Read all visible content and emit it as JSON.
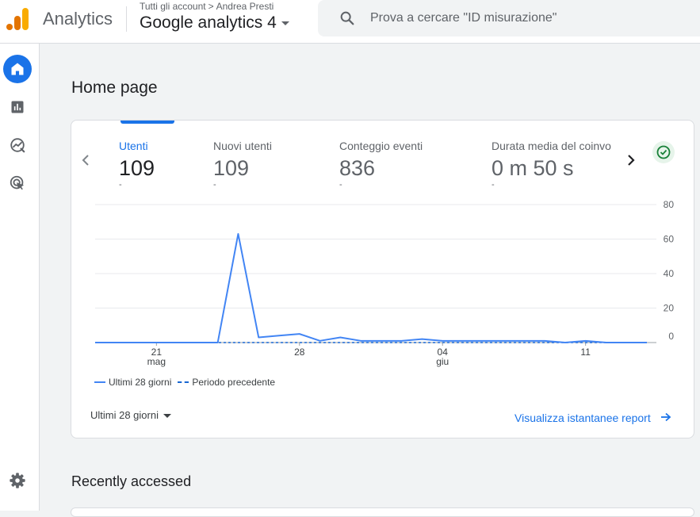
{
  "header": {
    "product_name": "Analytics",
    "breadcrumb": {
      "parent": "Tutti gli account",
      "separator": ">",
      "account": "Andrea Presti"
    },
    "property_name": "Google analytics 4",
    "search_placeholder": "Prova a cercare \"ID misurazione\""
  },
  "nav": {
    "items": [
      {
        "icon": "home-icon",
        "active": true
      },
      {
        "icon": "reports-icon",
        "active": false
      },
      {
        "icon": "explore-icon",
        "active": false
      },
      {
        "icon": "advertising-icon",
        "active": false
      }
    ],
    "settings_icon": "gear-icon"
  },
  "main": {
    "page_title": "Home page",
    "metrics": [
      {
        "label": "Utenti",
        "value": "109",
        "delta": "-"
      },
      {
        "label": "Nuovi utenti",
        "value": "109",
        "delta": "-"
      },
      {
        "label": "Conteggio eventi",
        "value": "836",
        "delta": "-"
      },
      {
        "label": "Durata media del coinvo",
        "value": "0 m 50 s",
        "delta": "-"
      }
    ],
    "legend": {
      "current": "Ultimi 28 giorni",
      "previous": "Periodo precedente"
    },
    "date_range": "Ultimi 28 giorni",
    "report_link": "Visualizza istantanee report",
    "recently_accessed": "Recently accessed"
  },
  "colors": {
    "accent": "#1a73e8",
    "series": "#4285f4",
    "success": "#188038"
  },
  "chart_data": {
    "type": "line",
    "x": [
      "18 mag",
      "19 mag",
      "20 mag",
      "21 mag",
      "22 mag",
      "23 mag",
      "24 mag",
      "25 mag",
      "26 mag",
      "27 mag",
      "28 mag",
      "29 mag",
      "30 mag",
      "31 mag",
      "01 giu",
      "02 giu",
      "03 giu",
      "04 giu",
      "05 giu",
      "06 giu",
      "07 giu",
      "08 giu",
      "09 giu",
      "10 giu",
      "11 giu",
      "12 giu",
      "13 giu",
      "14 giu"
    ],
    "series": [
      {
        "name": "Ultimi 28 giorni",
        "values": [
          0,
          0,
          0,
          0,
          0,
          0,
          0,
          63,
          3,
          4,
          5,
          1,
          3,
          1,
          1,
          1,
          2,
          1,
          1,
          1,
          1,
          1,
          1,
          0,
          1,
          0,
          0,
          0
        ]
      },
      {
        "name": "Periodo precedente",
        "values": [
          0,
          0,
          0,
          0,
          0,
          0,
          0,
          0,
          0,
          0,
          0,
          0,
          0,
          0,
          0,
          0,
          0,
          0,
          0,
          0,
          0,
          0,
          0,
          0,
          0,
          0,
          0,
          0
        ]
      }
    ],
    "x_ticks": [
      {
        "day": "21",
        "month": "mag",
        "index": 3
      },
      {
        "day": "28",
        "month": "",
        "index": 10
      },
      {
        "day": "04",
        "month": "giu",
        "index": 17
      },
      {
        "day": "11",
        "month": "",
        "index": 24
      }
    ],
    "y_ticks": [
      0,
      20,
      40,
      60,
      80
    ],
    "ylim": [
      0,
      80
    ],
    "grid": true,
    "legend": "bottom-left"
  }
}
